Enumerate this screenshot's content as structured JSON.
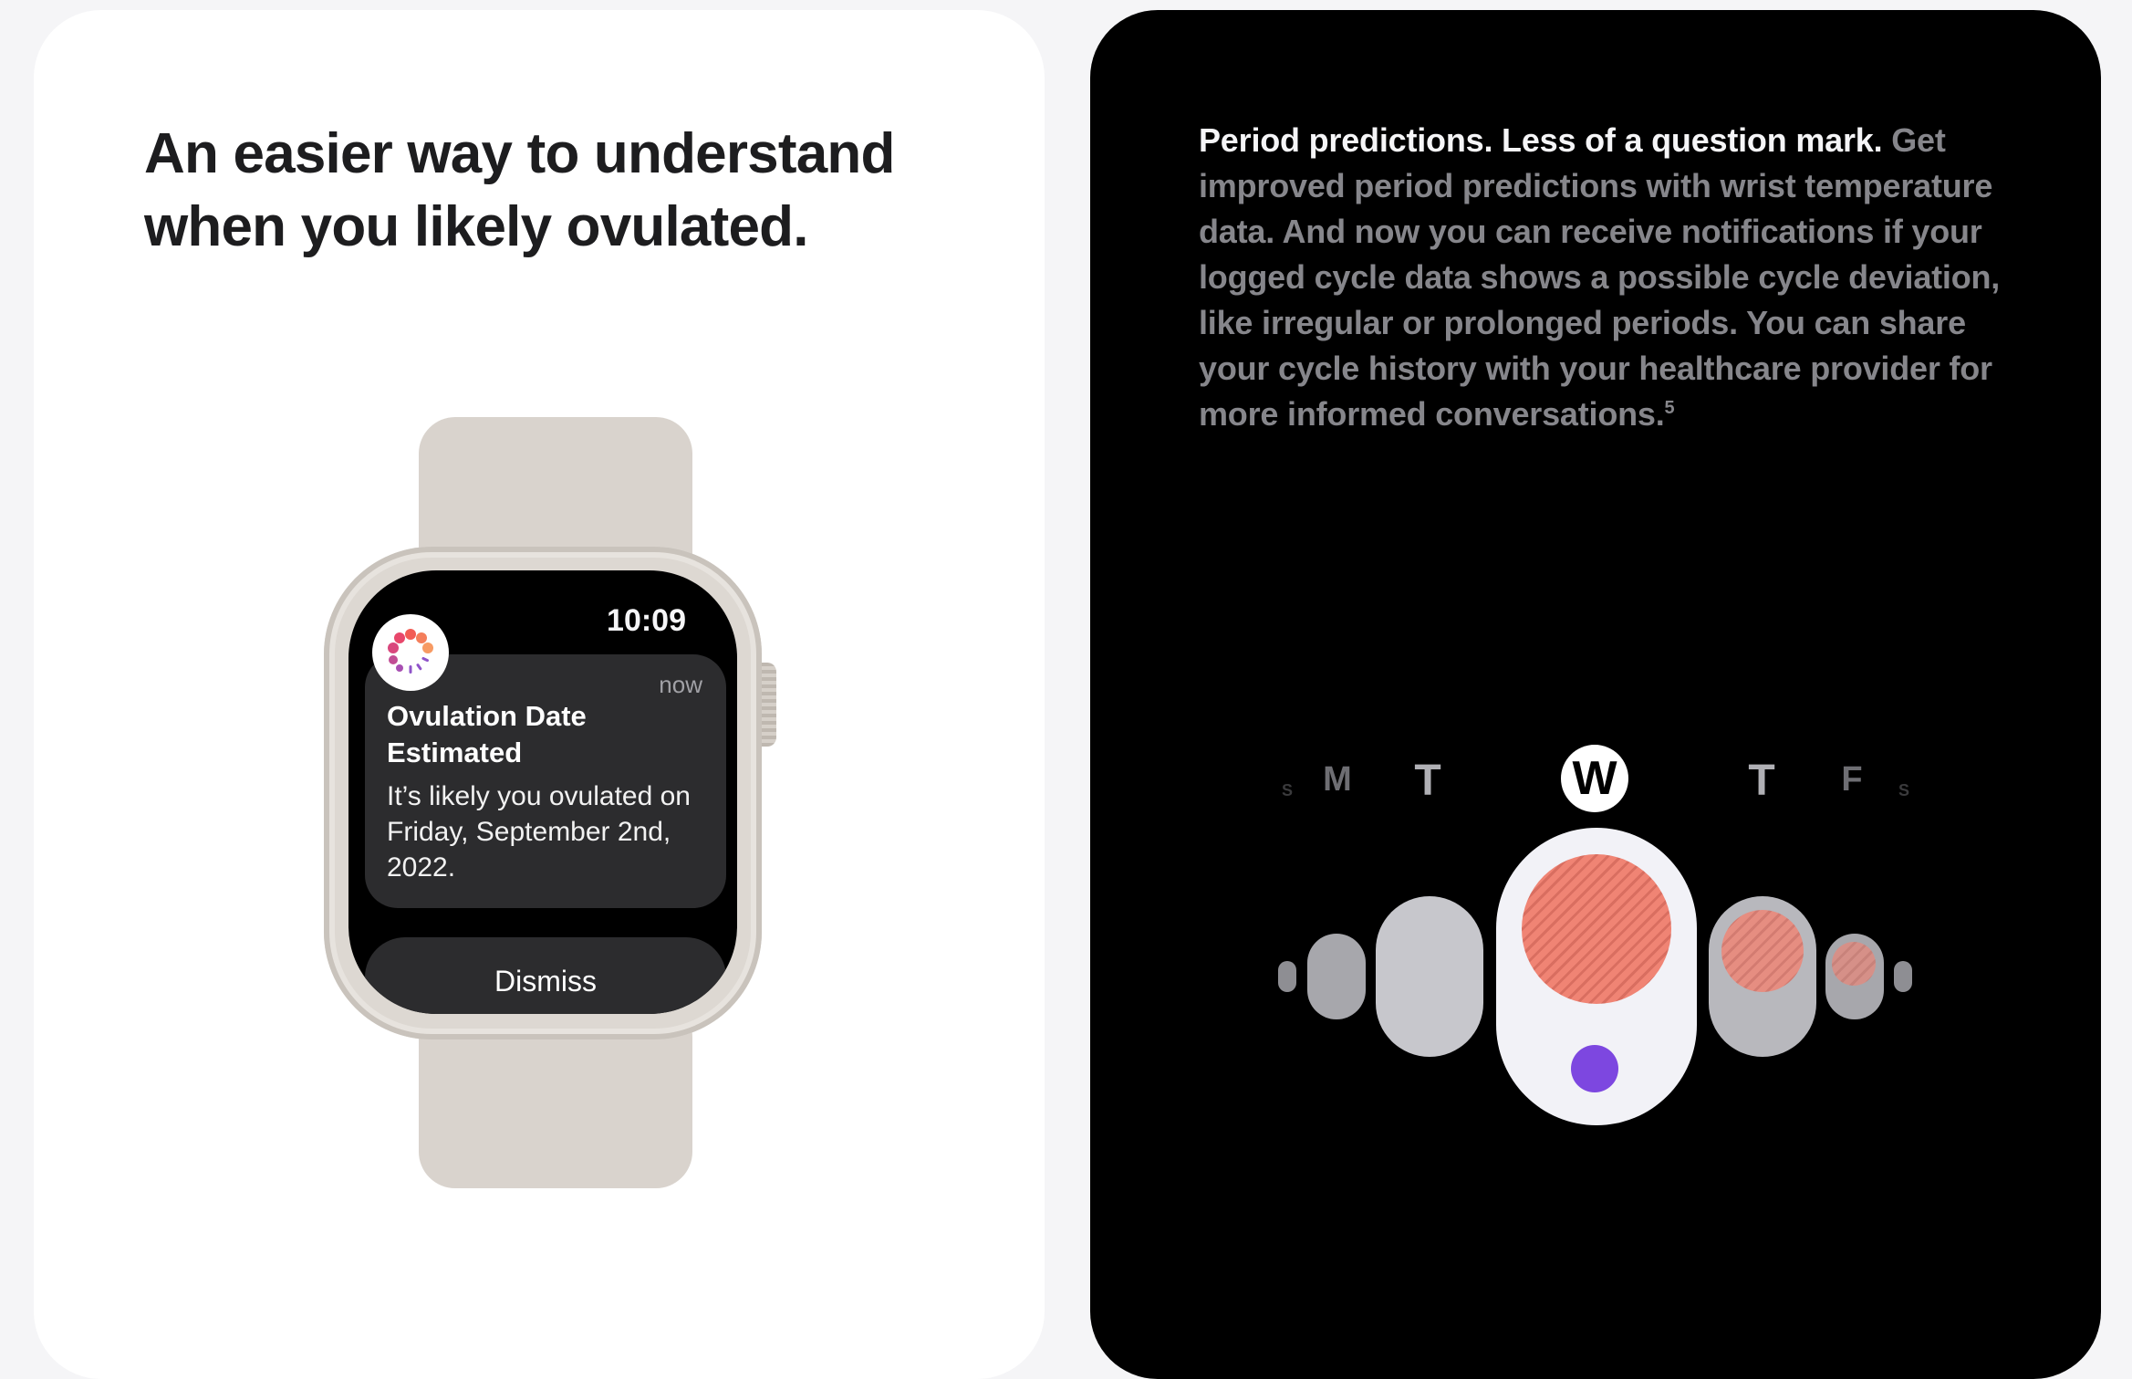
{
  "left_tile": {
    "heading": "An easier way to understand when you likely ovulated."
  },
  "watch": {
    "time": "10:09",
    "notification": {
      "app_icon": "cycle-tracking-icon",
      "timestamp": "now",
      "title": "Ovulation Date Estimated",
      "body": "It’s likely you ovulated on Friday, September 2nd, 2022."
    },
    "dismiss_label": "Dismiss"
  },
  "right_tile": {
    "lead": "Period predictions. Less of a question mark.",
    "body": " Get improved period predictions with wrist temperature data. And now you can receive notifications if your logged cycle data shows a possible cycle deviation, like irregular or prolonged periods. You can share your cycle history with your healthcare provider for more informed conversations.",
    "footnote": "5"
  },
  "cycle_graphic": {
    "days": [
      "S",
      "M",
      "T",
      "W",
      "T",
      "F",
      "S"
    ],
    "selected_day": "W",
    "colors": {
      "period": "#f08474",
      "fertile": "#7d47e0",
      "selected_bg": "#f2f2f7",
      "day_bg": "#c7c7cc"
    }
  },
  "colors": {
    "page_bg": "#f5f5f7",
    "heading_text": "#1d1d1f",
    "muted_text": "#86868b"
  }
}
